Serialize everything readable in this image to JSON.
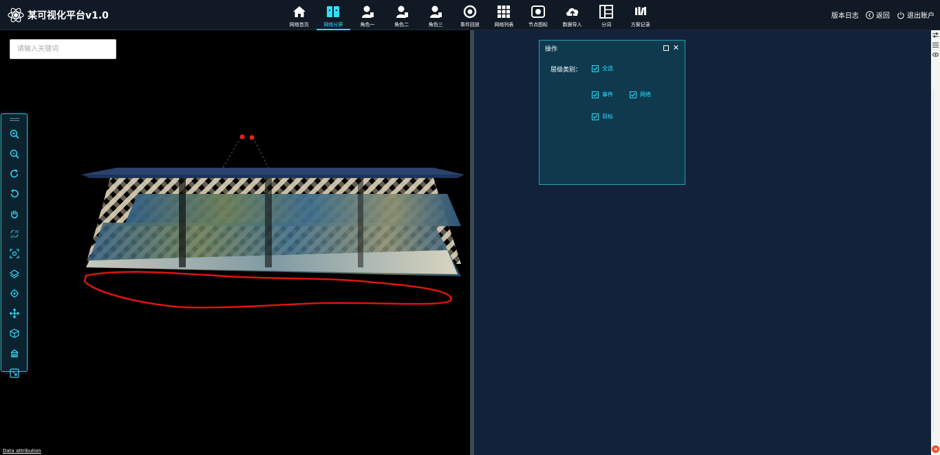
{
  "app": {
    "title": "某可视化平台v1.0"
  },
  "nav": {
    "items": [
      {
        "label": "网络首页",
        "icon": "home-icon"
      },
      {
        "label": "网络分屏",
        "icon": "split-screen-icon",
        "active": true
      },
      {
        "label": "角色一",
        "icon": "person-icon"
      },
      {
        "label": "角色二",
        "icon": "person-icon"
      },
      {
        "label": "角色三",
        "icon": "person-icon"
      },
      {
        "label": "事件回放",
        "icon": "replay-icon"
      },
      {
        "label": "网络列表",
        "icon": "grid-icon"
      },
      {
        "label": "节点图标",
        "icon": "image-icon"
      },
      {
        "label": "数据导入",
        "icon": "cloud-upload-icon"
      },
      {
        "label": "分词",
        "icon": "layout-icon"
      },
      {
        "label": "方案记录",
        "icon": "records-icon"
      }
    ],
    "accent": "#2de0ff"
  },
  "header_right": {
    "version_log": "版本日志",
    "back": "返回",
    "logout": "退出账户"
  },
  "search": {
    "placeholder": "请输入关键词"
  },
  "toolbar": {
    "tools": [
      "zoom-in-icon",
      "zoom-out-icon",
      "rotate-right-icon",
      "rotate-left-icon",
      "pan-hand-icon",
      "2d-3d-icon",
      "focus-icon",
      "layer-icon",
      "locate-icon",
      "move-icon",
      "cube-icon",
      "building-icon",
      "fit-icon"
    ]
  },
  "attribution": "Data attribution",
  "panel": {
    "title": "操作",
    "category_label": "层级类别：",
    "select_all": "全选",
    "options": [
      "事件",
      "网络",
      "目标"
    ]
  }
}
